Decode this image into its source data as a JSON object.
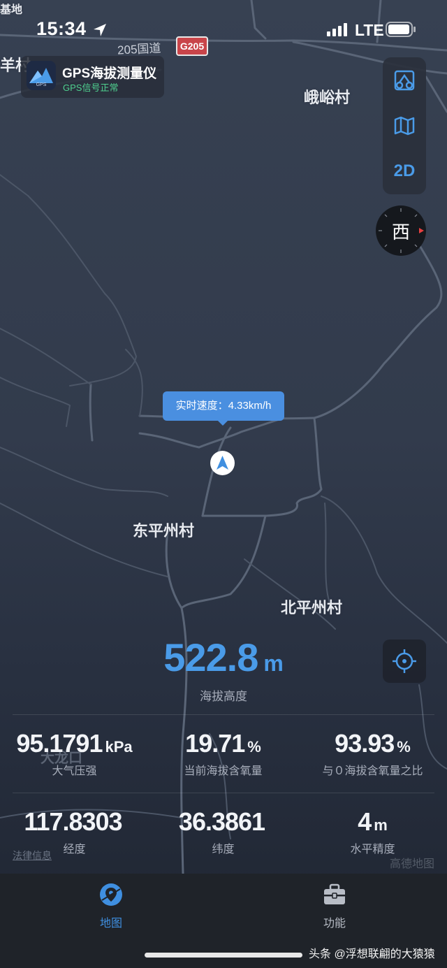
{
  "status_bar": {
    "time": "15:34",
    "network": "LTE"
  },
  "app_badge": {
    "name": "GPS海拔测量仪",
    "status": "GPS信号正常",
    "icon_caption": "GPS"
  },
  "map": {
    "places": [
      {
        "label": "基地"
      },
      {
        "label": "羊村"
      },
      {
        "label": "峨峪村"
      },
      {
        "label": "东平州村"
      },
      {
        "label": "北平州村"
      }
    ],
    "road_name": "205国道",
    "road_shield": "G205",
    "legal_link": "法律信息",
    "provider_watermark": "高德地图",
    "faded_label": "大龙口"
  },
  "map_controls": {
    "tools": [
      {
        "icon": "route-tool-icon"
      },
      {
        "icon": "map-layer-icon"
      },
      {
        "label": "2D"
      }
    ],
    "compass_direction": "西",
    "locate_icon": "crosshair-icon"
  },
  "speed_bubble": {
    "text": "实时速度：4.33km/h"
  },
  "altitude": {
    "value": "522.8",
    "unit": "m",
    "label": "海拔高度"
  },
  "stats": [
    {
      "value": "95.1791",
      "unit": "kPa",
      "label": "大气压强"
    },
    {
      "value": "19.71",
      "unit": "%",
      "label": "当前海拔含氧量"
    },
    {
      "value": "93.93",
      "unit": "%",
      "label": "与０海拔含氧量之比"
    },
    {
      "value": "117.8303",
      "unit": "",
      "label": "经度"
    },
    {
      "value": "36.3861",
      "unit": "",
      "label": "纬度"
    },
    {
      "value": "4",
      "unit": "m",
      "label": "水平精度"
    }
  ],
  "tabs": [
    {
      "label": "地图",
      "icon": "map-pin-icon",
      "active": true
    },
    {
      "label": "功能",
      "icon": "toolbox-icon",
      "active": false
    }
  ],
  "colors": {
    "accent": "#4a9be8",
    "tab_active": "#3f8fe0",
    "tab_inactive": "#b8bdc6",
    "gps_ok": "#4fd08f"
  },
  "watermark": "头条 @浮想联翩的大猿猿"
}
